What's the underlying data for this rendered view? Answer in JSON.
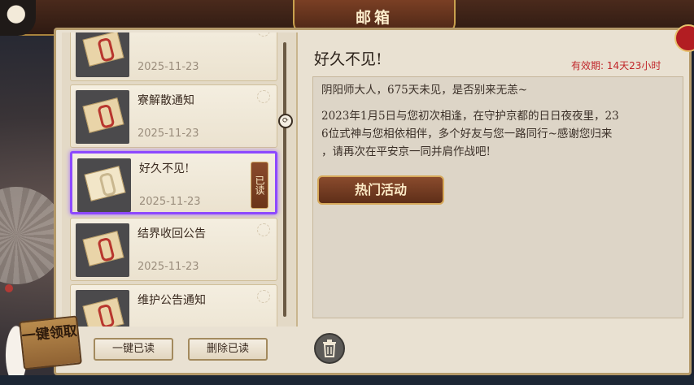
{
  "header": {
    "title": "邮箱"
  },
  "mail_list": [
    {
      "title": "",
      "date": "2025-11-23",
      "read": false
    },
    {
      "title": "寮解散通知",
      "date": "2025-11-23",
      "read": false
    },
    {
      "title": "好久不见!",
      "date": "2025-11-23",
      "read": true,
      "selected": true,
      "read_label": "已读"
    },
    {
      "title": "结界收回公告",
      "date": "2025-11-23",
      "read": false
    },
    {
      "title": "维护公告通知",
      "date": "",
      "read": false
    }
  ],
  "actions": {
    "claim_all": "一键领取",
    "read_all": "一键已读",
    "delete_read": "删除已读",
    "hot_event": "热门活动"
  },
  "detail": {
    "title": "好久不见!",
    "expiry": "有效期: 14天23小时",
    "lines": [
      "阴阳师大人，675天未见，是否别来无恙~",
      "2023年1月5日与您初次相逢，在守护京都的日日夜夜里，23",
      "6位式神与您相依相伴，多个好友与您一路同行~感谢您归来",
      "，请再次在平安京一同并肩作战吧!"
    ]
  },
  "colors": {
    "selected_border": "#8d49ff",
    "expiry": "#c0262a",
    "accent": "#c9a14e"
  }
}
